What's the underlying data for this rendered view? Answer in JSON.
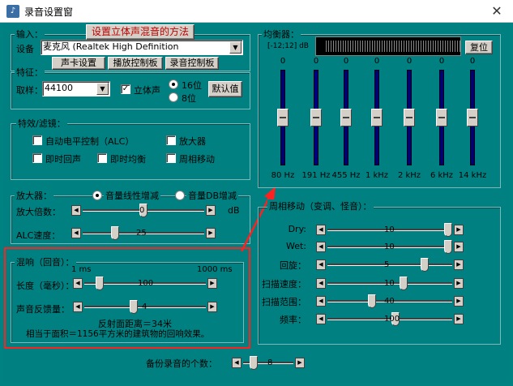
{
  "window": {
    "title": "录音设置窗",
    "icon": "app-icon",
    "close_glyph": "✕"
  },
  "input": {
    "group_label": "输入：",
    "stereo_mix_button": "设置立体声混音的方法",
    "device_label": "设备",
    "device_value": "麦克风 (Realtek High Definition",
    "buttons": [
      "声卡设置",
      "播放控制板",
      "录音控制板"
    ]
  },
  "feature": {
    "group_label": "特征：",
    "sample_label": "取样：",
    "sample_value": "44100",
    "stereo_label": "立体声",
    "stereo_checked": true,
    "bit16_label": "16位",
    "bit8_label": "8位",
    "bit16_selected": true,
    "default_button": "默认值"
  },
  "effects": {
    "group_label": "特效/滤镜：",
    "agc_label": "自动电平控制（ALC）",
    "amp_label": "放大器",
    "echo_label": "即时回声",
    "eq_label": "即时均衡",
    "phase_label": "周相移动"
  },
  "amplifier": {
    "group_label": "放大器：",
    "linear_label": "音量线性增减",
    "db_label": "音量DB增减",
    "linear_selected": true,
    "gain_label": "放大倍数：",
    "gain_value": "0",
    "gain_level": 0.5,
    "gain_unit": "dB",
    "alc_label": "ALC速度：",
    "alc_value": "25",
    "alc_level": 0.25
  },
  "reverb": {
    "group_label": "混响（回音）：",
    "min_label": "1 ms",
    "max_label": "1000 ms",
    "length_label": "长度（毫秒）：",
    "length_value": "100",
    "length_level": 0.1,
    "feedback_label": "声音反馈量：",
    "feedback_value": "4",
    "feedback_level": 0.4,
    "info_line1": "反射面距离＝34米",
    "info_line2": "相当于面积＝1156平方米的建筑物的回响效果。"
  },
  "equalizer": {
    "group_label": "均衡器：",
    "range_label": "[-12;12] dB",
    "reset_button": "复位",
    "bands": [
      {
        "freq": "80 Hz",
        "value": "0"
      },
      {
        "freq": "191 Hz",
        "value": "0"
      },
      {
        "freq": "455 Hz",
        "value": "0"
      },
      {
        "freq": "1 kHz",
        "value": "0"
      },
      {
        "freq": "2 kHz",
        "value": "0"
      },
      {
        "freq": "6 kHz",
        "value": "0"
      },
      {
        "freq": "14 kHz",
        "value": "0"
      }
    ]
  },
  "phase_shift": {
    "group_label": "周相移动（变调、怪音）：",
    "rows": [
      {
        "label": "Dry:",
        "value": "10",
        "level": 1.0
      },
      {
        "label": "Wet:",
        "value": "10",
        "level": 1.0
      },
      {
        "label": "回旋：",
        "value": "5",
        "level": 0.8
      },
      {
        "label": "扫描速度：",
        "value": "10",
        "level": 0.62
      },
      {
        "label": "扫描范围：",
        "value": "40",
        "level": 0.35
      },
      {
        "label": "频率：",
        "value": "100",
        "level": 0.55
      }
    ]
  },
  "backup": {
    "label": "备份录音的个数：",
    "value": "8",
    "level": 0.15
  },
  "colors": {
    "background": "#008080",
    "highlight": "#ff2020",
    "eq_bar": "#00007f"
  }
}
